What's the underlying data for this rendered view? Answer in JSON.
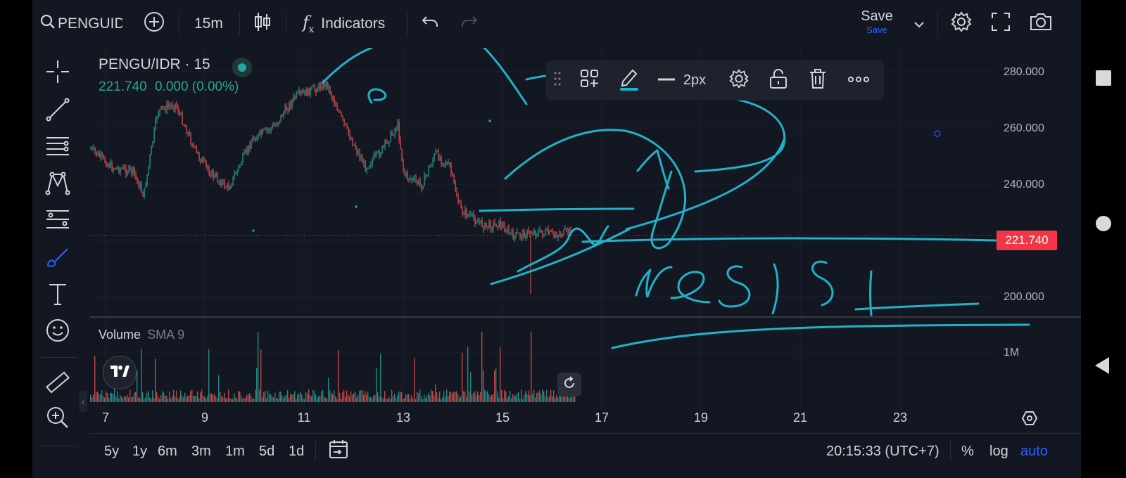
{
  "topbar": {
    "symbol": "PENGUIDR",
    "interval": "15m",
    "indicators_label": "Indicators",
    "save_label": "Save",
    "save_sub": "Save"
  },
  "legend": {
    "title": "PENGU/IDR · 15",
    "price": "221.740",
    "change": "0.000 (0.00%)",
    "volume_label": "Volume",
    "volume_indicator": "SMA 9"
  },
  "price_axis": {
    "ticks": [
      "280.000",
      "260.000",
      "240.000",
      "200.000"
    ],
    "current": "221.740",
    "volume_tick": "1M"
  },
  "time_axis": {
    "ticks": [
      "7",
      "9",
      "11",
      "13",
      "15",
      "17",
      "19",
      "21",
      "23"
    ]
  },
  "drawing_toolbar": {
    "width_label": "2px"
  },
  "bottombar": {
    "ranges": [
      "5y",
      "1y",
      "6m",
      "3m",
      "1m",
      "5d",
      "1d"
    ],
    "clock": "20:15:33 (UTC+7)",
    "percent": "%",
    "log": "log",
    "auto": "auto"
  },
  "annotation_text": "resist",
  "colors": {
    "background": "#131722",
    "up": "#26a69a",
    "down": "#ef5350",
    "drawing": "#20b2c8",
    "price_tag": "#f23645",
    "accent": "#2962ff"
  },
  "icons": [
    "search-icon",
    "plus-circle-icon",
    "candles-icon",
    "fx-icon",
    "undo-icon",
    "redo-icon",
    "chevron-down-icon",
    "gear-icon",
    "fullscreen-icon",
    "camera-icon",
    "crosshair-icon",
    "trendline-icon",
    "fib-icon",
    "pattern-icon",
    "forecast-icon",
    "brush-icon",
    "text-icon",
    "emoji-icon",
    "ruler-icon",
    "zoom-in-icon",
    "drag-handle-icon",
    "add-template-icon",
    "pencil-icon",
    "line-width-icon",
    "lock-open-icon",
    "trash-icon",
    "more-icon",
    "reset-icon",
    "calendar-range-icon",
    "tv-logo-icon",
    "hexagon-gear-icon"
  ]
}
